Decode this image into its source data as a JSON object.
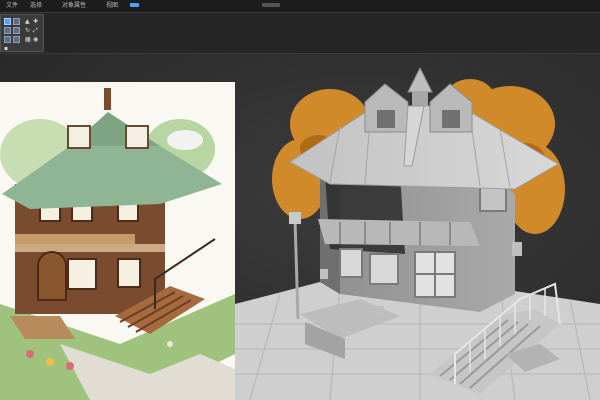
{
  "menubar": {
    "items": [
      {
        "label": "文件",
        "name": "menu-file"
      },
      {
        "label": "选择",
        "name": "menu-select"
      },
      {
        "label": "对象属性",
        "name": "menu-object-props"
      },
      {
        "label": "视图",
        "name": "menu-view"
      }
    ],
    "accent_color": "#4aa3ff"
  },
  "toolbar": {
    "tools": [
      "select-tool",
      "move-tool",
      "rotate-tool",
      "scale-tool",
      "mirror-tool",
      "snap-tool"
    ],
    "icons": [
      "select-icon",
      "move-icon",
      "rotate-icon",
      "scale-icon",
      "grid-icon",
      "camera-icon"
    ]
  },
  "viewport": {
    "background": "#2f2f2f",
    "reference_image": "illustrated-house-reference",
    "model": "grey-3d-house-model",
    "foliage_color": "#d08a2a"
  }
}
